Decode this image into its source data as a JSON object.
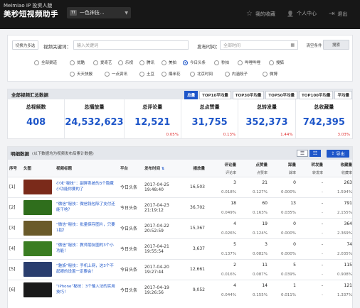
{
  "header": {
    "brand_en": "Meimiao IP 投资人版",
    "brand_cn": "美秒短视频助手",
    "channel_logo": "TT",
    "channel": "一色神技...",
    "nav": [
      {
        "icon": "star-icon",
        "glyph": "☆",
        "label": "我的收藏"
      },
      {
        "icon": "user-icon",
        "glyph": "👤",
        "label": "个人中心"
      },
      {
        "icon": "logout-icon",
        "glyph": "⇥",
        "label": "退出"
      }
    ]
  },
  "filter": {
    "toggle": "切换为多选",
    "kw_label": "视频关键词：",
    "kw_placeholder": "输入关键词",
    "time_label": "发布时间：",
    "time_placeholder": "全部时间",
    "clear": "清空条件",
    "search": "搜索",
    "platforms": [
      "全部渠道",
      "优酷",
      "爱奇艺",
      "乐视",
      "腾讯",
      "美拍",
      "今日头条",
      "秒拍",
      "哔哩哔哩",
      "搜狐",
      "天天快报",
      "一点资讯",
      "土豆",
      "爆米花",
      "北京时间",
      "内涵段子",
      "微博"
    ],
    "selected": "今日头条"
  },
  "summary": {
    "title": "全部视频汇总数据",
    "tabs": [
      "总量",
      "TOP10平均量",
      "TOP30平均量",
      "TOP50平均量",
      "TOP100平均量",
      "平均量"
    ],
    "stats": [
      {
        "label": "总视频数",
        "value": "408",
        "pct": ""
      },
      {
        "label": "总播放量",
        "value": "24,532,623",
        "pct": ""
      },
      {
        "label": "总评论量",
        "value": "12,521",
        "pct": "0.05%"
      },
      {
        "label": "总点赞量",
        "value": "31,755",
        "pct": "0.13%"
      },
      {
        "label": "总转发量",
        "value": "352,373",
        "pct": "1.44%"
      },
      {
        "label": "总收藏量",
        "value": "742,395",
        "pct": "3.03%"
      }
    ]
  },
  "detail": {
    "title": "明细数据",
    "subtitle": "(以下数据均为视频发布后累计数据)",
    "export": "导出",
    "cols": {
      "idx": "序号",
      "thumb": "头图",
      "title": "视频标题",
      "platform": "平台",
      "time": "发布时间",
      "sort": "⇅",
      "play": "播放量",
      "comment": "评论量",
      "like": "点赞量",
      "dislike": "踩量",
      "share": "转发量",
      "fav": "收藏量"
    },
    "subcols": {
      "comment": "评论率",
      "like": "点赞率",
      "dislike": "踩率",
      "share": "转发率",
      "fav": "收藏率"
    },
    "rows": [
      {
        "idx": "[1]",
        "title": "小米“秘技”：副屏系统的3个隐藏小功能你要的了",
        "platform": "今日头条",
        "date": "2017-04-25",
        "tm": "19:48:40",
        "play": "16,503",
        "c": "3",
        "cr": "0.018%",
        "l": "21",
        "lr": "0.127%",
        "d": "0",
        "dr": "0.000%",
        "s": "-",
        "sr": "-",
        "f": "263",
        "fr": "1.594%"
      },
      {
        "idx": "[2]",
        "title": "“微信”秘技：微信钱包除了支付还能干啥？",
        "platform": "今日头条",
        "date": "2017-04-23",
        "tm": "21:19:12",
        "play": "36,702",
        "c": "18",
        "cr": "0.049%",
        "l": "60",
        "lr": "0.163%",
        "d": "13",
        "dr": "0.035%",
        "s": "-",
        "sr": "-",
        "f": "791",
        "fr": "2.155%"
      },
      {
        "idx": "[3]",
        "title": "“微信”秘技：批量保存图片，只要1招！",
        "platform": "今日头条",
        "date": "2017-04-22",
        "tm": "20:52:59",
        "play": "15,367",
        "c": "4",
        "cr": "0.026%",
        "l": "19",
        "lr": "0.124%",
        "d": "0",
        "dr": "0.000%",
        "s": "-",
        "sr": "-",
        "f": "364",
        "fr": "2.369%"
      },
      {
        "idx": "[4]",
        "title": "“微信”秘技：教师朋友圈的3个小功能！",
        "platform": "今日头条",
        "date": "2017-04-21",
        "tm": "19:55:54",
        "play": "3,637",
        "c": "5",
        "cr": "0.137%",
        "l": "3",
        "lr": "0.082%",
        "d": "0",
        "dr": "0.000%",
        "s": "-",
        "sr": "-",
        "f": "74",
        "fr": "2.035%"
      },
      {
        "idx": "[5]",
        "title": "“魅族”秘技：手机上网，这3个不起眼的设置一定要会！",
        "platform": "今日头条",
        "date": "2017-04-20",
        "tm": "19:27:44",
        "play": "12,661",
        "c": "2",
        "cr": "0.016%",
        "l": "11",
        "lr": "0.087%",
        "d": "5",
        "dr": "0.039%",
        "s": "-",
        "sr": "-",
        "f": "115",
        "fr": "0.908%"
      },
      {
        "idx": "[6]",
        "title": "“iPhone”秘技：3个输入法的实用技巧！",
        "platform": "今日头条",
        "date": "2017-04-19",
        "tm": "19:26:56",
        "play": "9,052",
        "c": "4",
        "cr": "0.044%",
        "l": "14",
        "lr": "0.155%",
        "d": "1",
        "dr": "0.011%",
        "s": "-",
        "sr": "-",
        "f": "121",
        "fr": "1.337%"
      }
    ]
  },
  "colors": {
    "accent": "#1e56c9",
    "header_bg": "#171717",
    "pct_red": "#e03030",
    "thumb_green": "#3d6b24"
  }
}
